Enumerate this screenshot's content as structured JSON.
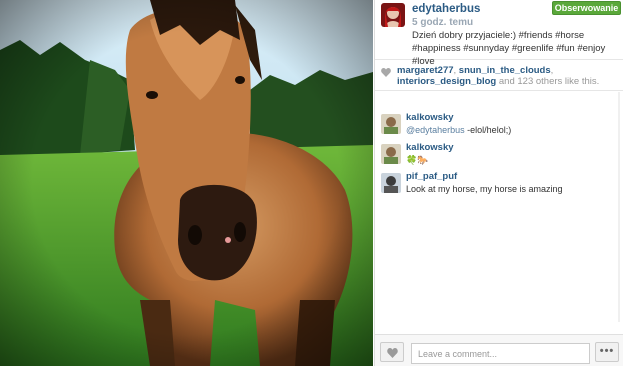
{
  "post": {
    "username": "edytaherbus",
    "time": "5 godz. temu",
    "follow_label": "Obserwowanie",
    "caption": "Dzień dobry przyjaciele:) #friends #horse #happiness #sunnyday #greenlife #fun #enjoy #love"
  },
  "likes": {
    "users": [
      "margaret277",
      "snun_in_the_clouds",
      "interiors_design_blog"
    ],
    "sep1": ", ",
    "sep2": ",",
    "and": " and ",
    "others_count": "123",
    "others_tail": " others like this."
  },
  "comments": [
    {
      "user": "kalkowsky",
      "mention": "@edytaherbus",
      "text": " -elol/helol;)"
    },
    {
      "user": "kalkowsky",
      "mention": "",
      "text": "🍀🐎"
    },
    {
      "user": "pif_paf_puf",
      "mention": "",
      "text": "Look at my horse, my horse is amazing"
    }
  ],
  "footer": {
    "comment_placeholder": "Leave a comment...",
    "more_label": "•••"
  },
  "colors": {
    "follow_green": "#5aa83a",
    "link_blue": "#2b5b84"
  },
  "icons": {
    "heart": "heart-icon",
    "more": "more-options-icon"
  }
}
